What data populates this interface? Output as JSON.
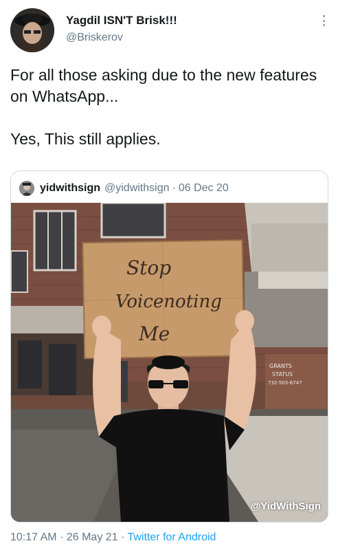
{
  "tweet": {
    "display_name": "Yagdil ISN'T Brisk!!!",
    "handle": "@Briskerov",
    "text_line1": "For all those asking due to the new features on WhatsApp...",
    "text_line2": "Yes, This still applies.",
    "time": "10:17 AM",
    "date": "26 May 21",
    "source": "Twitter for Android"
  },
  "quoted": {
    "name": "yidwithsign",
    "handle": "@yidwithsign",
    "date": "06 Dec 20",
    "sign_lines": [
      "Stop",
      "Voicenoting",
      "Me"
    ],
    "watermark": "@YidWithSign",
    "wall_sign": [
      "GRANTS",
      "STATUS",
      "732-503-6747"
    ]
  },
  "icons": {
    "more": "more-vertical-icon"
  },
  "colors": {
    "link": "#1da1f2",
    "secondary_text": "#657786",
    "border": "#cfd9de"
  }
}
